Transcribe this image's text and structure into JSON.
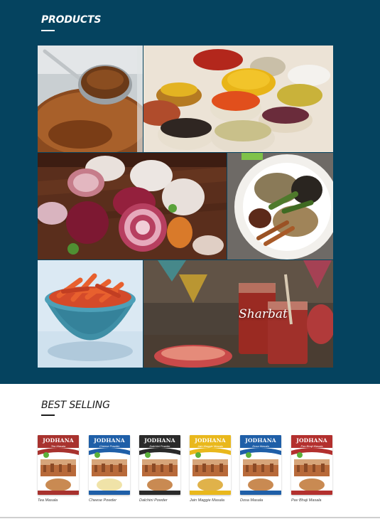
{
  "products_section": {
    "title": "PRODUCTS",
    "tiles": [
      {
        "name": "spice-powder-spoon"
      },
      {
        "name": "spice-bowls"
      },
      {
        "name": "onion-garlic"
      },
      {
        "name": "whole-spices-plate"
      },
      {
        "name": "pickle-bowl"
      },
      {
        "name": "sharbat",
        "label": "Sharbat"
      }
    ]
  },
  "best_selling": {
    "title": "BEST SELLING",
    "items": [
      {
        "brand": "JODHANA",
        "sub": "Tea Masala",
        "name": "Tea Masala",
        "color": "#a8322e"
      },
      {
        "brand": "JODHANA",
        "sub": "Cheese Powder",
        "name": "Cheese Powder",
        "color": "#1f5fa8"
      },
      {
        "brand": "JODHANA",
        "sub": "Dalchini Powder",
        "name": "Dalchini Powder",
        "color": "#2a2a2a"
      },
      {
        "brand": "JODHANA",
        "sub": "Jain Maggie Masala",
        "name": "Jain Maggie Masala",
        "color": "#e9b81c"
      },
      {
        "brand": "JODHANA",
        "sub": "Dosa Masala",
        "name": "Dosa Masala",
        "color": "#1f5fa8"
      },
      {
        "brand": "JODHANA",
        "sub": "Pav Bhaji Masala",
        "name": "Pav Bhaji Masala",
        "color": "#b3302e"
      }
    ]
  }
}
